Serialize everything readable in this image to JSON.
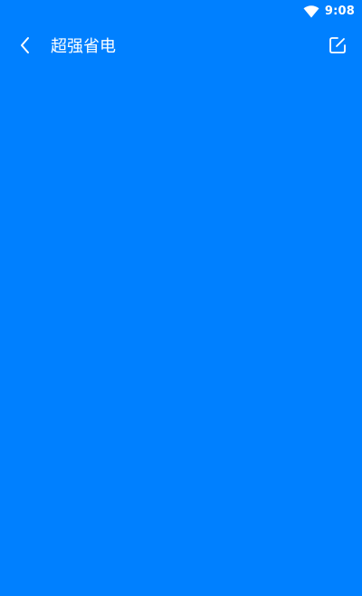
{
  "status_bar": {
    "time": "9:08",
    "wifi_icon": "wifi-icon"
  },
  "app_bar": {
    "back_icon": "chevron-left-icon",
    "title": "超强省电",
    "edit_icon": "edit-icon"
  },
  "colors": {
    "background": "#0080ff",
    "foreground": "#ffffff"
  }
}
